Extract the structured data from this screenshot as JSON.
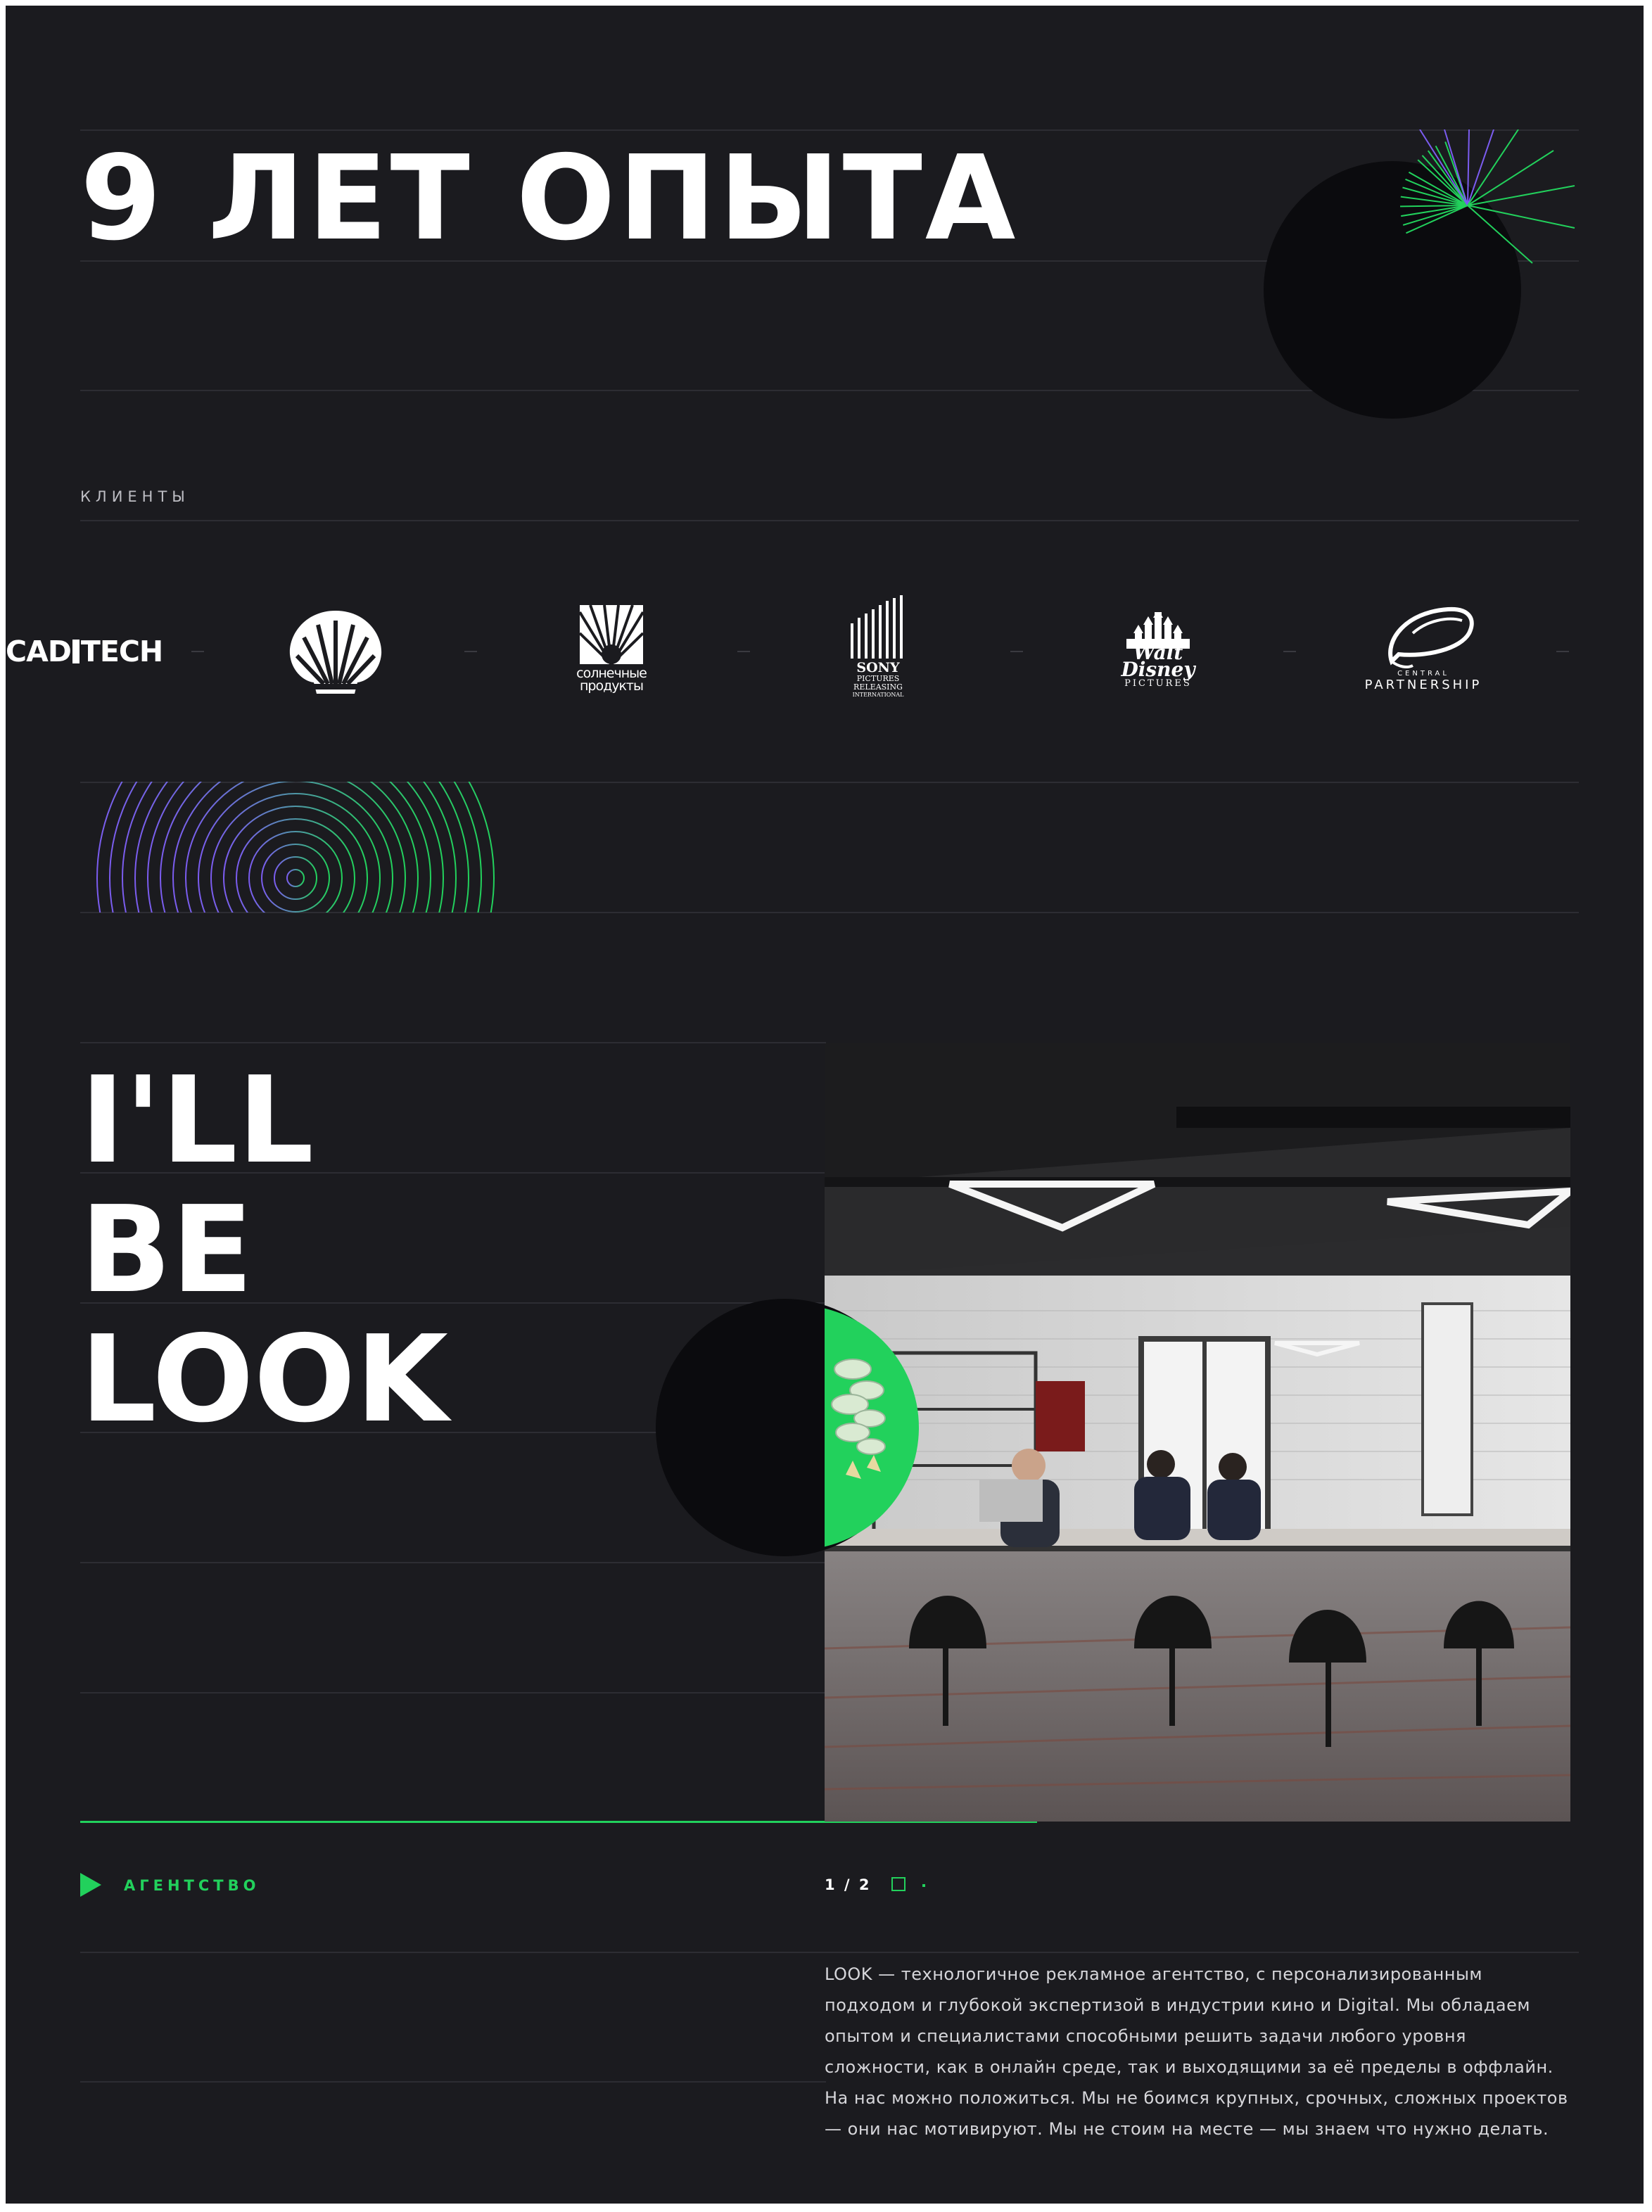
{
  "hero": {
    "title": "9 ЛЕТ ОПЫТА"
  },
  "clients": {
    "label": "КЛИЕНТЫ",
    "logos": [
      {
        "name": "CADTECH",
        "parts": [
          "CAD",
          "TECH"
        ],
        "icon": "cadtech-logo"
      },
      {
        "name": "Shell",
        "icon": "shell-logo"
      },
      {
        "name": "солнечные продукты",
        "lines": [
          "солнечные",
          "продукты"
        ],
        "icon": "sun-logo"
      },
      {
        "name": "Sony Pictures Releasing International",
        "lines": [
          "SONY",
          "PICTURES",
          "RELEASING",
          "INTERNATIONAL"
        ],
        "icon": "sony-pictures-logo"
      },
      {
        "name": "Walt Disney Pictures",
        "lines": [
          "Walt Disney",
          "PICTURES"
        ],
        "icon": "disney-castle-logo"
      },
      {
        "name": "Central Partnership",
        "lines": [
          "CENTRAL",
          "PARTNERSHIP"
        ],
        "icon": "central-partnership-logo"
      }
    ]
  },
  "agency": {
    "slogan_lines": [
      "I'LL",
      "BE",
      "LOOK"
    ],
    "tab_label": "АГЕНТСТВО",
    "slider": {
      "current": 1,
      "total": 2,
      "text": "1 / 2"
    },
    "description": "LOOK — технологичное рекламное агентство, с персонализированным подходом и глубокой экспертизой в индустрии кино и Digital. Мы обладаем опытом и специалистами способными решить задачи любого уровня сложности, как в онлайн среде, так и выходящими за её пределы в оффлайн. На нас можно положиться. Мы не боимся крупных, срочных, сложных проектов — они нас мотивируют. Мы не стоим на месте — мы знаем что нужно делать."
  },
  "colors": {
    "background": "#1b1b1f",
    "accent_green": "#22d15c",
    "accent_purple": "#7b5cf0",
    "line": "#2d2d33",
    "text": "#ffffff"
  }
}
